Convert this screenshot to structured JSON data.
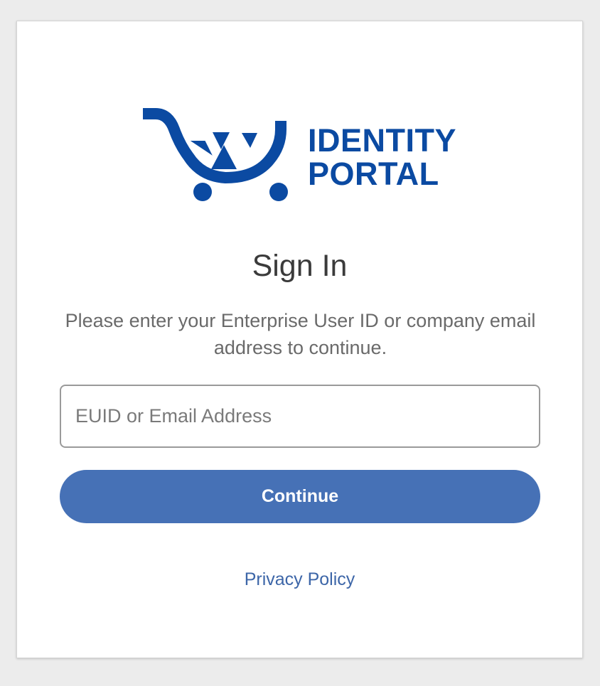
{
  "logo": {
    "line1": "IDENTITY",
    "line2": "PORTAL",
    "icon": "shopping-cart-icon",
    "color": "#0b4aa2"
  },
  "signin": {
    "title": "Sign In",
    "subtitle": "Please enter your Enterprise User ID or company email address to continue."
  },
  "form": {
    "username_placeholder": "EUID or Email Address",
    "username_value": "",
    "continue_label": "Continue"
  },
  "footer": {
    "privacy_label": "Privacy Policy"
  },
  "colors": {
    "accent": "#4671b6",
    "link": "#3d66a8",
    "background": "#ececec"
  }
}
